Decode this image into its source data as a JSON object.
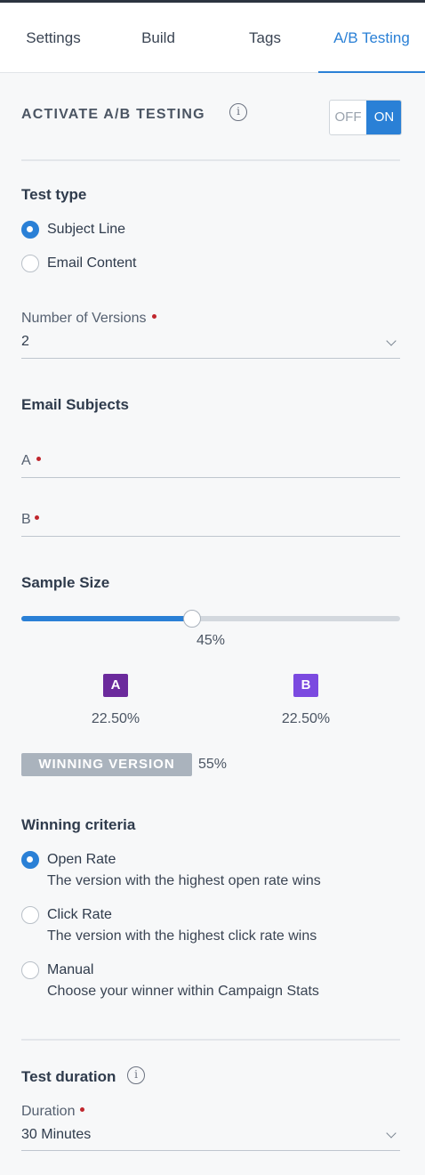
{
  "tabs": [
    {
      "label": "Settings"
    },
    {
      "label": "Build"
    },
    {
      "label": "Tags"
    },
    {
      "label": "A/B Testing"
    }
  ],
  "activate": {
    "label": "ACTIVATE A/B TESTING",
    "toggle_off": "OFF",
    "toggle_on": "ON",
    "state": "ON"
  },
  "test_type": {
    "heading": "Test type",
    "options": [
      {
        "label": "Subject Line",
        "checked": true
      },
      {
        "label": "Email Content",
        "checked": false
      }
    ]
  },
  "versions": {
    "label": "Number of Versions",
    "value": "2"
  },
  "email_subjects": {
    "heading": "Email Subjects",
    "a_label": "A",
    "b_label": "B"
  },
  "sample_size": {
    "heading": "Sample Size",
    "value_percent": 45,
    "value_text": "45%",
    "a_badge": "A",
    "b_badge": "B",
    "a_pct": "22.50%",
    "b_pct": "22.50%",
    "winning_label": "WINNING VERSION",
    "winning_pct": "55%"
  },
  "winning_criteria": {
    "heading": "Winning criteria",
    "options": [
      {
        "label": "Open Rate",
        "desc": "The version with the highest open rate wins",
        "checked": true
      },
      {
        "label": "Click Rate",
        "desc": "The version with the highest click rate wins",
        "checked": false
      },
      {
        "label": "Manual",
        "desc": "Choose your winner within Campaign Stats",
        "checked": false
      }
    ]
  },
  "duration": {
    "heading": "Test duration",
    "label": "Duration",
    "value": "30 Minutes"
  },
  "colors": {
    "accent": "#2a80d6",
    "badge_a": "#6b2a9c",
    "badge_b": "#7b4ae0",
    "required": "#c0262d"
  },
  "icons": {
    "info": "info-icon",
    "chevron": "chevron-down-icon"
  }
}
